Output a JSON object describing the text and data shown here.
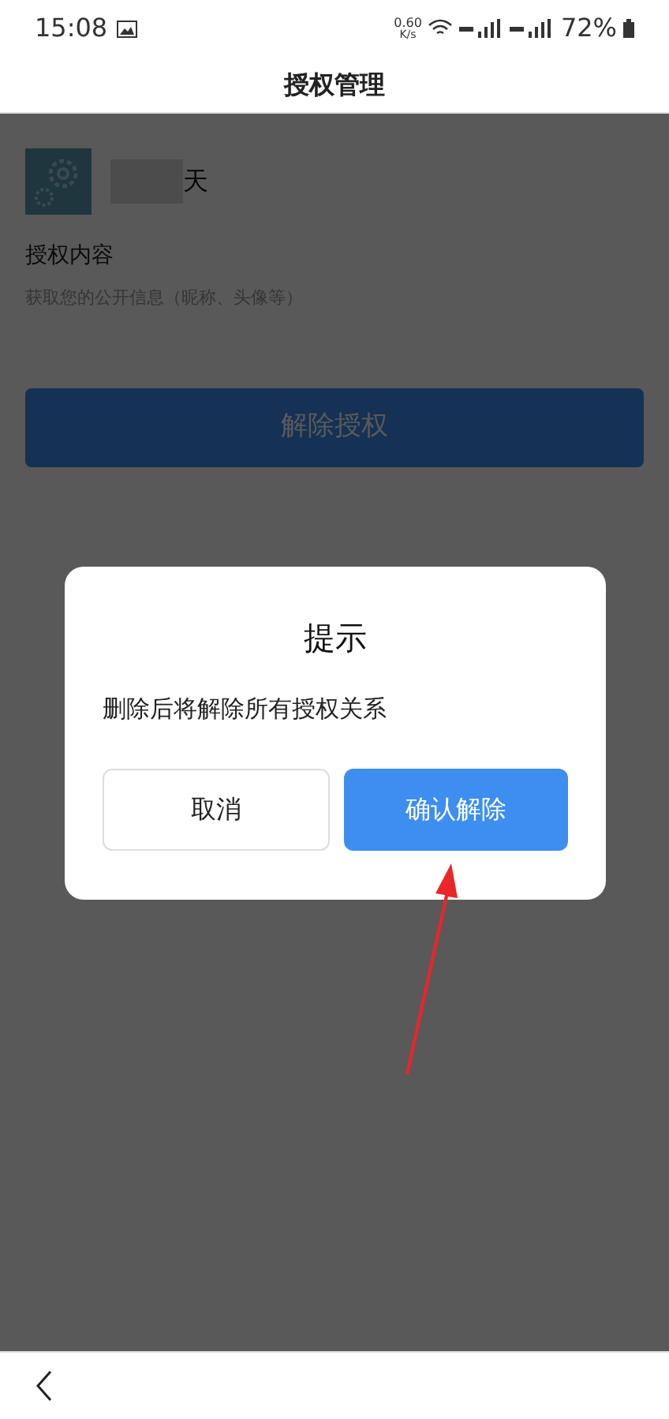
{
  "status_bar": {
    "time": "15:08",
    "speed": "0.60",
    "speed_unit": "K/s",
    "battery": "72%"
  },
  "header": {
    "title": "授权管理"
  },
  "app": {
    "name_visible": "天"
  },
  "content": {
    "heading": "授权内容",
    "description": "获取您的公开信息（昵称、头像等）"
  },
  "revoke_button": {
    "label": "解除授权"
  },
  "dialog": {
    "title": "提示",
    "message": "删除后将解除所有授权关系",
    "buttons": [
      {
        "label": "取消",
        "kind": "secondary"
      },
      {
        "label": "确认解除",
        "kind": "primary"
      }
    ]
  }
}
